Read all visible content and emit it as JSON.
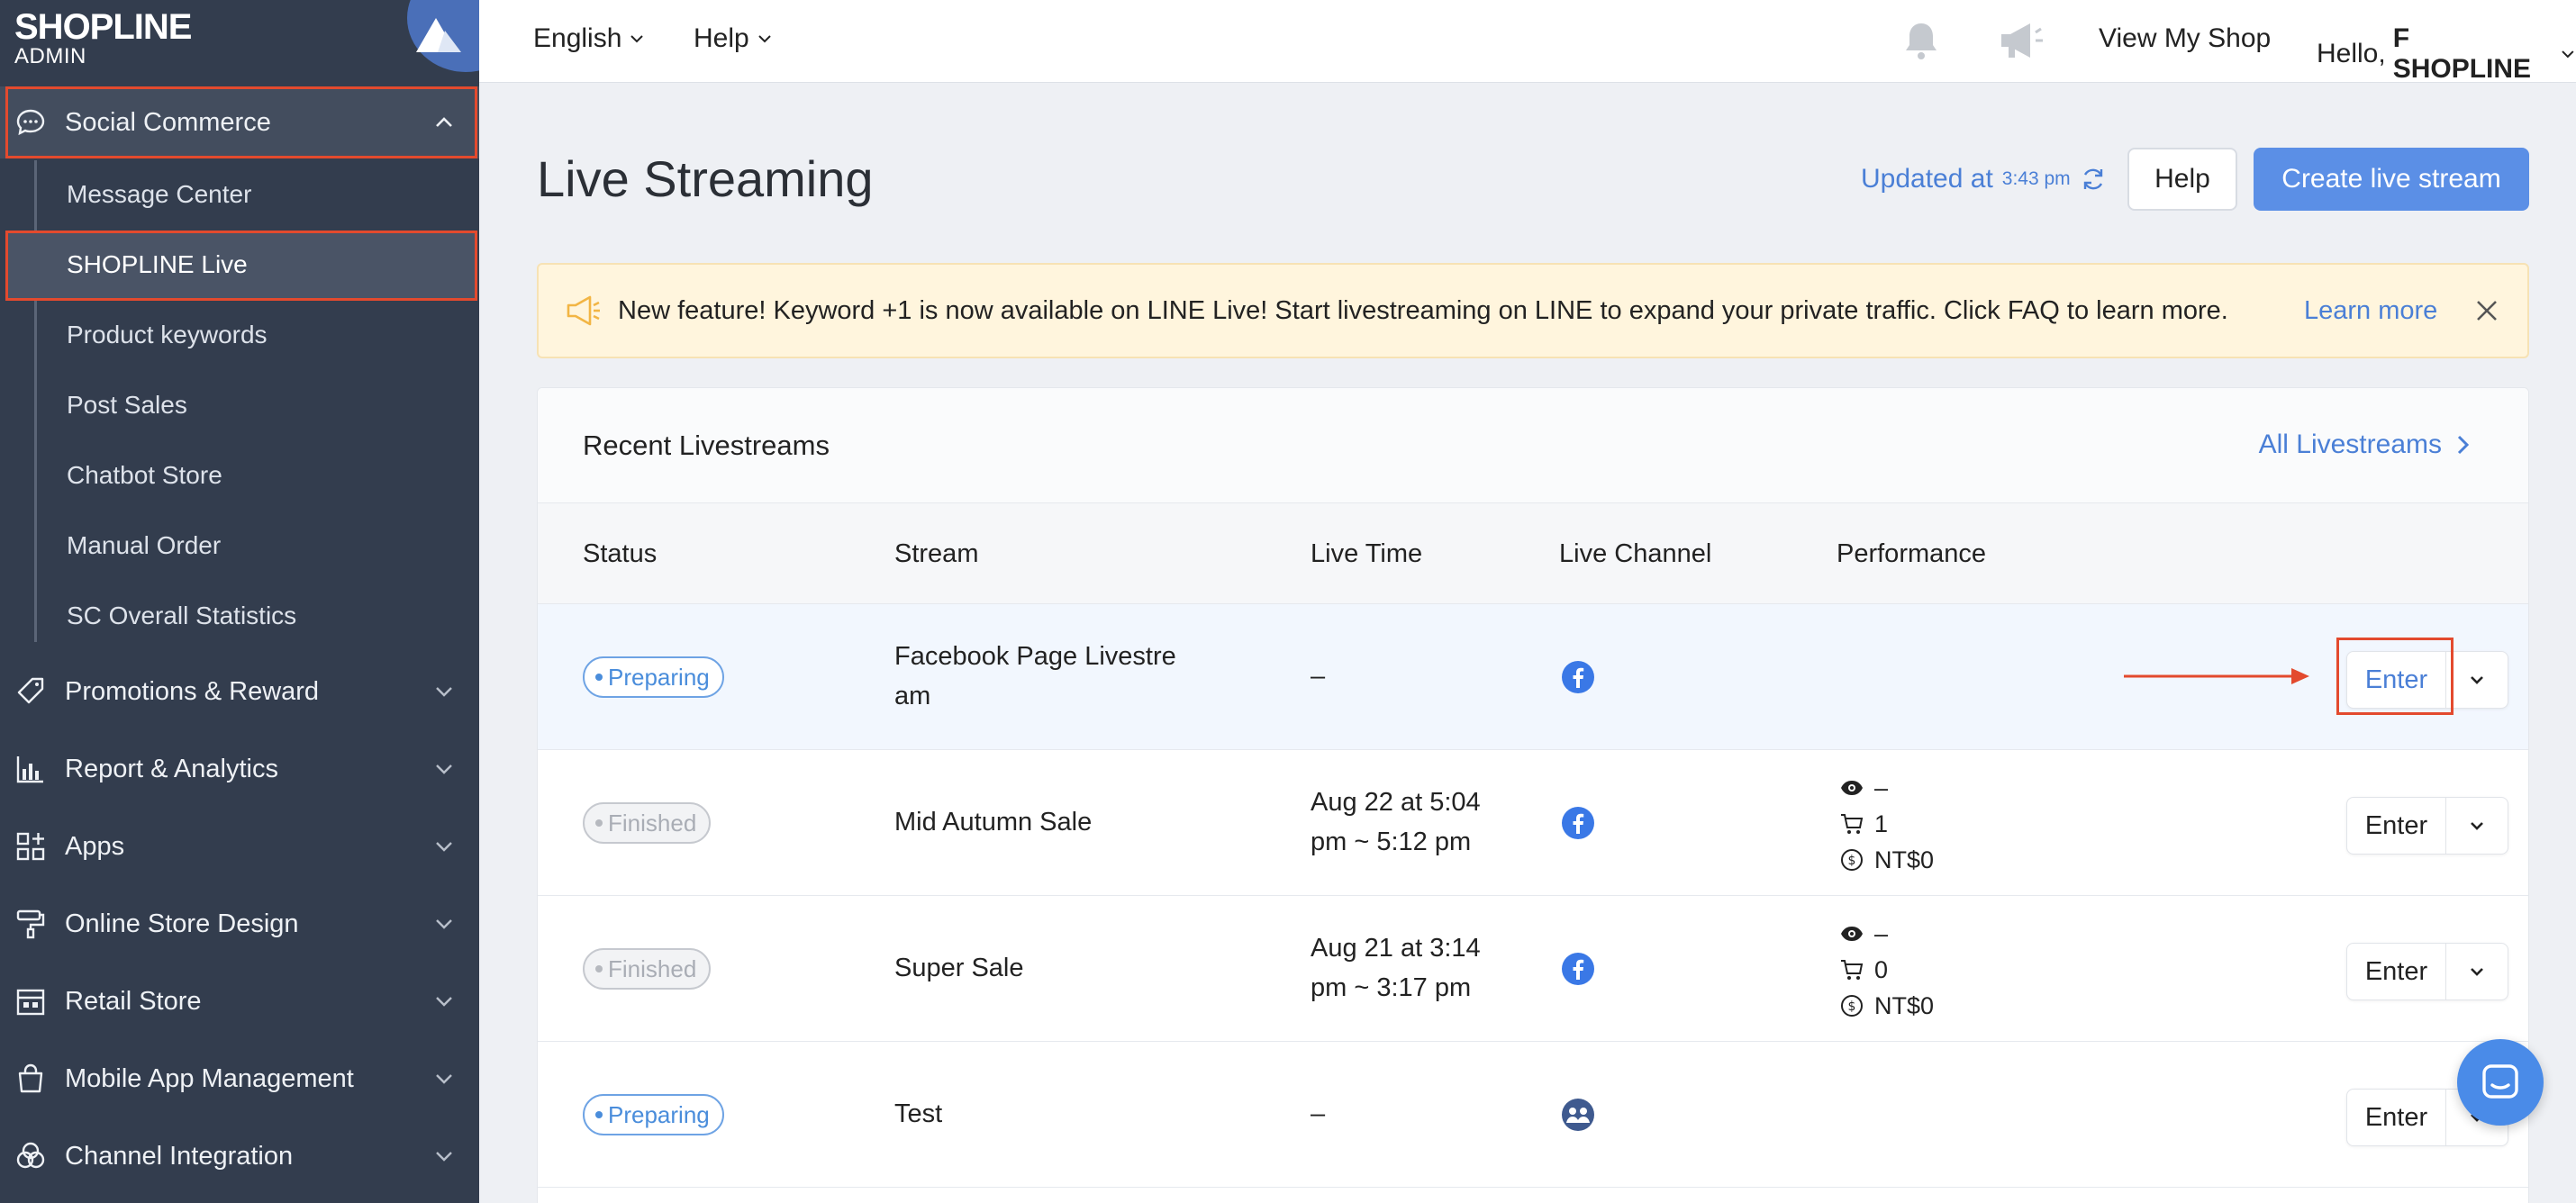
{
  "brand": {
    "logo": "SHOPLINE",
    "sub": "ADMIN"
  },
  "sidebar": {
    "social_commerce": "Social Commerce",
    "sub_items": [
      "Message Center",
      "SHOPLINE Live",
      "Product keywords",
      "Post Sales",
      "Chatbot Store",
      "Manual Order",
      "SC Overall Statistics"
    ],
    "items": [
      {
        "label": "Promotions & Reward",
        "icon": "tag-icon"
      },
      {
        "label": "Report & Analytics",
        "icon": "bar-chart-icon"
      },
      {
        "label": "Apps",
        "icon": "apps-grid-icon"
      },
      {
        "label": "Online Store Design",
        "icon": "paint-roller-icon"
      },
      {
        "label": "Retail Store",
        "icon": "store-icon"
      },
      {
        "label": "Mobile App Management",
        "icon": "shopping-bag-icon"
      },
      {
        "label": "Channel Integration",
        "icon": "circles-icon"
      }
    ]
  },
  "topbar": {
    "language": "English",
    "help": "Help",
    "view_shop": "View My Shop",
    "greeting": "Hello,",
    "user": "F SHOPLINE"
  },
  "page": {
    "title": "Live Streaming",
    "updated_label": "Updated at",
    "updated_time": "3:43 pm",
    "help_button": "Help",
    "create_button": "Create live stream"
  },
  "notice": {
    "text": "New feature! Keyword +1 is now available on LINE Live! Start livestreaming on LINE to expand your private traffic. Click FAQ to learn more.",
    "link": "Learn more"
  },
  "panel": {
    "title": "Recent Livestreams",
    "all_link": "All Livestreams",
    "columns": [
      "Status",
      "Stream",
      "Live Time",
      "Live Channel",
      "Performance"
    ],
    "rows": [
      {
        "status": "Preparing",
        "stream_line1": "Facebook Page Livestre",
        "stream_line2": "am",
        "time_line1": "–",
        "time_line2": "",
        "channel": "facebook-icon",
        "views": "",
        "orders": "",
        "sales": "",
        "enter": "Enter"
      },
      {
        "status": "Finished",
        "stream_line1": "Mid Autumn Sale",
        "stream_line2": "",
        "time_line1": "Aug 22 at 5:04",
        "time_line2": "pm ~ 5:12 pm",
        "channel": "facebook-icon",
        "views": "–",
        "orders": "1",
        "sales": "NT$0",
        "enter": "Enter"
      },
      {
        "status": "Finished",
        "stream_line1": "Super Sale",
        "stream_line2": "",
        "time_line1": "Aug 21 at 3:14",
        "time_line2": "pm ~ 3:17 pm",
        "channel": "facebook-icon",
        "views": "–",
        "orders": "0",
        "sales": "NT$0",
        "enter": "Enter"
      },
      {
        "status": "Preparing",
        "stream_line1": "Test",
        "stream_line2": "",
        "time_line1": "–",
        "time_line2": "",
        "channel": "group-icon",
        "views": "",
        "orders": "",
        "sales": "",
        "enter": "Enter"
      }
    ]
  },
  "colors": {
    "sidebar": "#333d4e",
    "accent": "#5b8fe6",
    "highlight": "#e34a2e",
    "link": "#4a7fd6"
  }
}
